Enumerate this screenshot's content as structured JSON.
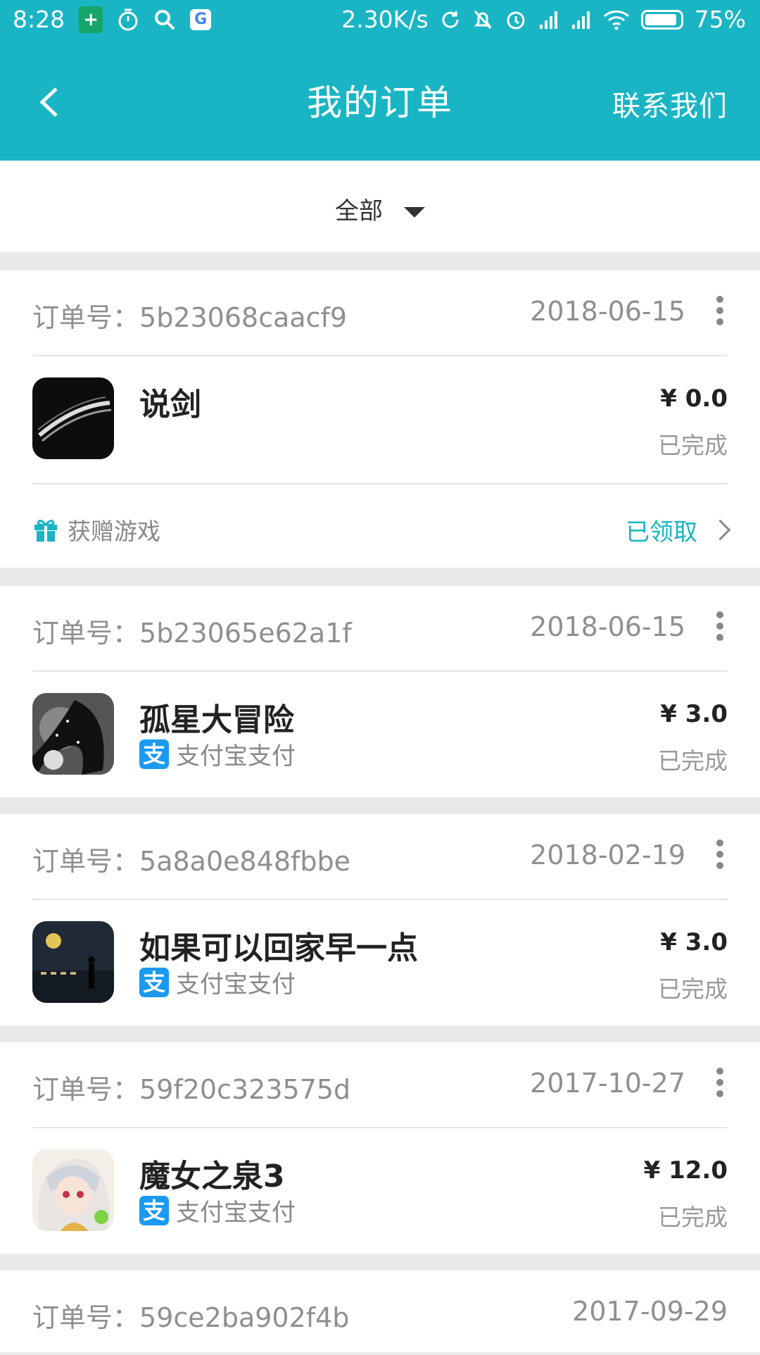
{
  "status_bar": {
    "time": "8:28",
    "net_speed": "2.30K/s",
    "battery": "75%"
  },
  "nav": {
    "title": "我的订单",
    "contact": "联系我们"
  },
  "filter": {
    "label": "全部"
  },
  "order_no_label": "订单号：",
  "orders": [
    {
      "order_no": "5b23068caacf9",
      "date": "2018-06-15",
      "game": "说剑",
      "price": "¥ 0.0",
      "status": "已完成",
      "gift": {
        "label": "获赠游戏",
        "status": "已领取"
      }
    },
    {
      "order_no": "5b23065e62a1f",
      "date": "2018-06-15",
      "game": "孤星大冒险",
      "price": "¥ 3.0",
      "status": "已完成",
      "pay": "支付宝支付"
    },
    {
      "order_no": "5a8a0e848fbbe",
      "date": "2018-02-19",
      "game": "如果可以回家早一点",
      "price": "¥ 3.0",
      "status": "已完成",
      "pay": "支付宝支付"
    },
    {
      "order_no": "59f20c323575d",
      "date": "2017-10-27",
      "game": "魔女之泉3",
      "price": "¥ 12.0",
      "status": "已完成",
      "pay": "支付宝支付"
    },
    {
      "order_no": "59ce2ba902f4b",
      "date": "2017-09-29"
    }
  ],
  "alipay_glyph": "支",
  "colors": {
    "accent": "#1ab5c4",
    "alipay": "#1a9af0"
  },
  "icons": [
    "back-arrow-icon",
    "dropdown-triangle-icon",
    "more-vertical-icon",
    "gift-icon",
    "chevron-right-icon",
    "alipay-icon"
  ]
}
